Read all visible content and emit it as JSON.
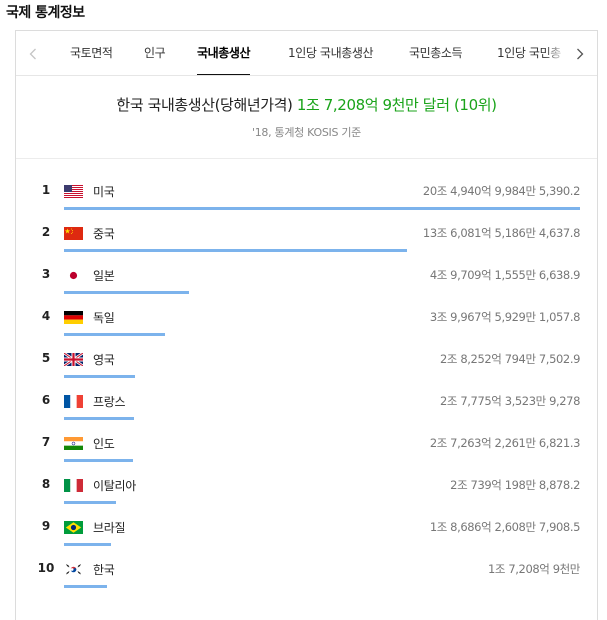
{
  "section_title": "국제 통계정보",
  "tabs": [
    {
      "label": "국토면적",
      "active": false
    },
    {
      "label": "인구",
      "active": false
    },
    {
      "label": "국내총생산",
      "active": true
    },
    {
      "label": "1인당 국내총생산",
      "active": false
    },
    {
      "label": "국민총소득",
      "active": false
    },
    {
      "label": "1인당 국민총",
      "active": false
    }
  ],
  "nav": {
    "prev_icon": "chevron-left-icon",
    "next_icon": "chevron-right-icon"
  },
  "headline": {
    "prefix": "한국 국내총생산(당해년가격)",
    "value": "1조 7,208억 9천만 달러 (10위)"
  },
  "source": "'18, 통계청 KOSIS 기준",
  "colors": {
    "accent_green": "#19a319",
    "bar": "#7cb3ec"
  },
  "rankings": [
    {
      "rank": "1",
      "country": "미국",
      "flag": "us",
      "value": "20조 4,940억 9,984만 5,390.2",
      "fraction": 1.0
    },
    {
      "rank": "2",
      "country": "중국",
      "flag": "cn",
      "value": "13조 6,081억 5,186만 4,637.8",
      "fraction": 0.664
    },
    {
      "rank": "3",
      "country": "일본",
      "flag": "jp",
      "value": "4조 9,709억 1,555만 6,638.9",
      "fraction": 0.243
    },
    {
      "rank": "4",
      "country": "독일",
      "flag": "de",
      "value": "3조 9,967억 5,929만 1,057.8",
      "fraction": 0.195
    },
    {
      "rank": "5",
      "country": "영국",
      "flag": "gb",
      "value": "2조 8,252억 794만 7,502.9",
      "fraction": 0.138
    },
    {
      "rank": "6",
      "country": "프랑스",
      "flag": "fr",
      "value": "2조 7,775억 3,523만 9,278",
      "fraction": 0.136
    },
    {
      "rank": "7",
      "country": "인도",
      "flag": "in",
      "value": "2조 7,263억 2,261만 6,821.3",
      "fraction": 0.133
    },
    {
      "rank": "8",
      "country": "이탈리아",
      "flag": "it",
      "value": "2조 739억 198만 8,878.2",
      "fraction": 0.101
    },
    {
      "rank": "9",
      "country": "브라질",
      "flag": "br",
      "value": "1조 8,686억 2,608만 7,908.5",
      "fraction": 0.091
    },
    {
      "rank": "10",
      "country": "한국",
      "flag": "kr",
      "value": "1조 7,208억 9천만",
      "fraction": 0.084
    }
  ]
}
